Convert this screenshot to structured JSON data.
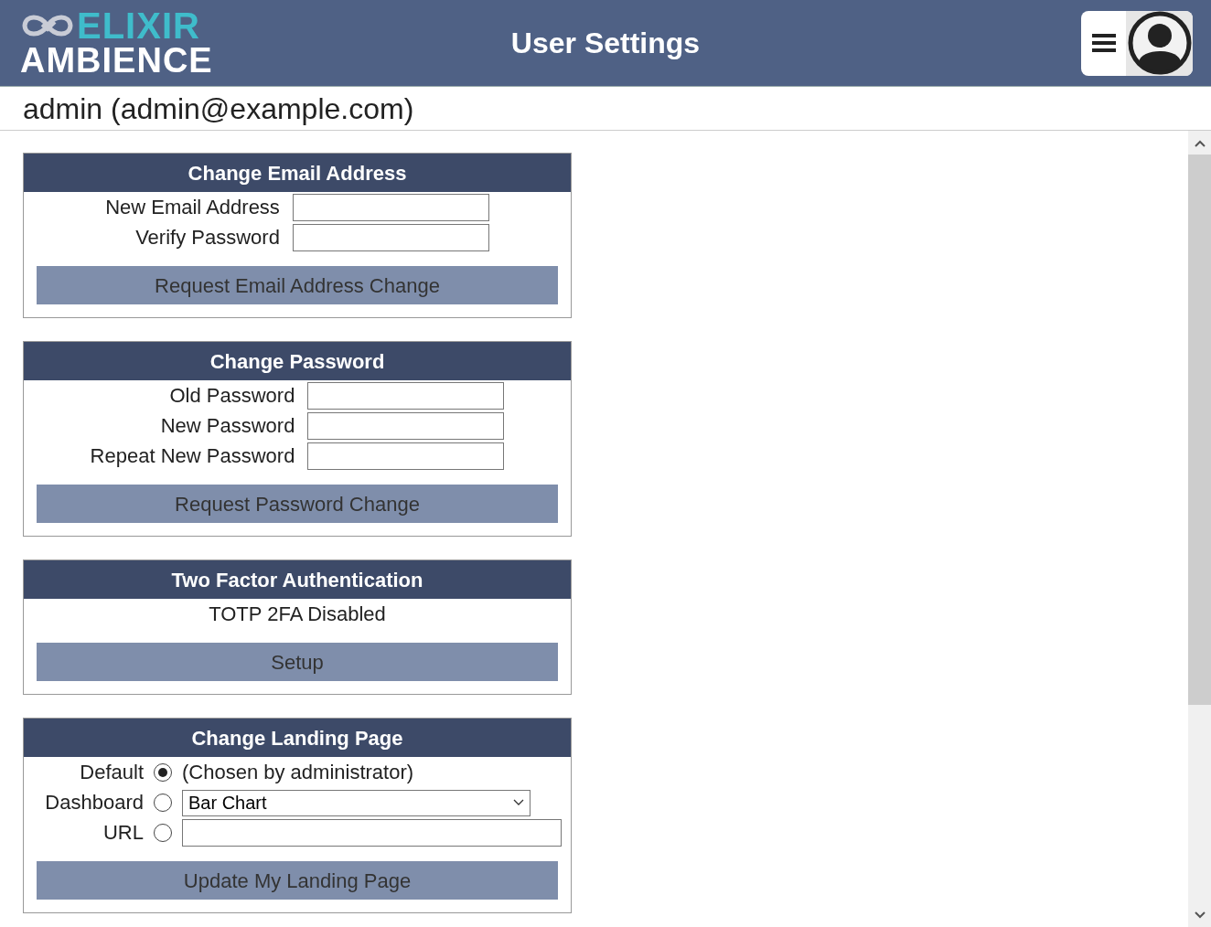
{
  "header": {
    "logo_top": "ELIXIR",
    "logo_bottom": "AMBIENCE",
    "title": "User Settings"
  },
  "user": "admin (admin@example.com)",
  "sections": [
    {
      "kind": "fields",
      "title": "Change Email Address",
      "fields": [
        {
          "label": "New Email Address"
        },
        {
          "label": "Verify Password"
        }
      ],
      "button": "Request Email Address Change"
    },
    {
      "kind": "fields",
      "title": "Change Password",
      "fields": [
        {
          "label": "Old Password"
        },
        {
          "label": "New Password"
        },
        {
          "label": "Repeat New Password"
        }
      ],
      "button": "Request Password Change"
    },
    {
      "kind": "status",
      "title": "Two Factor Authentication",
      "status": "TOTP 2FA Disabled",
      "button": "Setup"
    },
    {
      "kind": "landing",
      "title": "Change Landing Page",
      "options": [
        {
          "label": "Default",
          "selected": true,
          "kind": "text",
          "text": "(Chosen by administrator)"
        },
        {
          "label": "Dashboard",
          "selected": false,
          "kind": "select",
          "value": "Bar Chart"
        },
        {
          "label": "URL",
          "selected": false,
          "kind": "input"
        }
      ],
      "button": "Update My Landing Page"
    }
  ]
}
